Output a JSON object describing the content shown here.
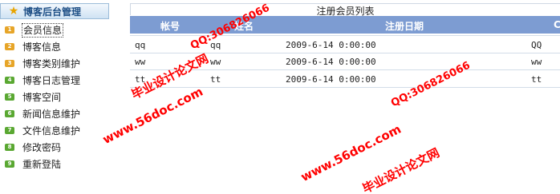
{
  "sidebar": {
    "title": "博客后台管理",
    "items": [
      {
        "num": "1",
        "label": "会员信息",
        "color": "#e7a528",
        "selected": true
      },
      {
        "num": "2",
        "label": "博客信息",
        "color": "#e7a528"
      },
      {
        "num": "3",
        "label": "博客类别维护",
        "color": "#e7a528"
      },
      {
        "num": "4",
        "label": "博客日志管理",
        "color": "#5aa832"
      },
      {
        "num": "5",
        "label": "博客空间",
        "color": "#5aa832"
      },
      {
        "num": "6",
        "label": "新闻信息维护",
        "color": "#5aa832"
      },
      {
        "num": "7",
        "label": "文件信息维护",
        "color": "#5aa832"
      },
      {
        "num": "8",
        "label": "修改密码",
        "color": "#5aa832"
      },
      {
        "num": "9",
        "label": "重新登陆",
        "color": "#5aa832"
      }
    ]
  },
  "table": {
    "caption": "注册会员列表",
    "headers": {
      "account": "帐号",
      "name": "姓名",
      "date": "注册日期",
      "extra": "C"
    },
    "rows": [
      {
        "account": "qq",
        "name": "qq",
        "date": "2009-6-14 0:00:00",
        "extra": "QQ"
      },
      {
        "account": "ww",
        "name": "ww",
        "date": "2009-6-14 0:00:00",
        "extra": "ww"
      },
      {
        "account": "tt",
        "name": "tt",
        "date": "2009-6-14 0:00:00",
        "extra": "tt"
      }
    ]
  },
  "watermarks": {
    "school": "毕业设计论文网",
    "qq": "QQ:306826066",
    "site": "www.56doc.com"
  },
  "colors": {
    "header_bg": "#7d9cd2",
    "watermark": "#ff0000",
    "sidebar_title": "#1e4f86"
  }
}
